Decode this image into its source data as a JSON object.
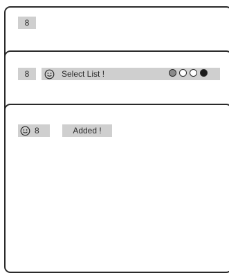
{
  "screen1": {
    "number": "8"
  },
  "screen2": {
    "number": "8",
    "message": "Select List !",
    "icon": "smiley-icon",
    "circles": [
      {
        "name": "circle-gray",
        "fill": "#8a8a8a"
      },
      {
        "name": "circle-white",
        "fill": "#ffffff"
      },
      {
        "name": "circle-white",
        "fill": "#ffffff"
      },
      {
        "name": "circle-black",
        "fill": "#1a1a1a"
      }
    ]
  },
  "screen3": {
    "number": "8",
    "message": "Added !",
    "icon": "smiley-icon"
  },
  "colors": {
    "osd_background": "#cfcfcf",
    "text": "#2a2a2a",
    "border": "#2a2a2a"
  }
}
